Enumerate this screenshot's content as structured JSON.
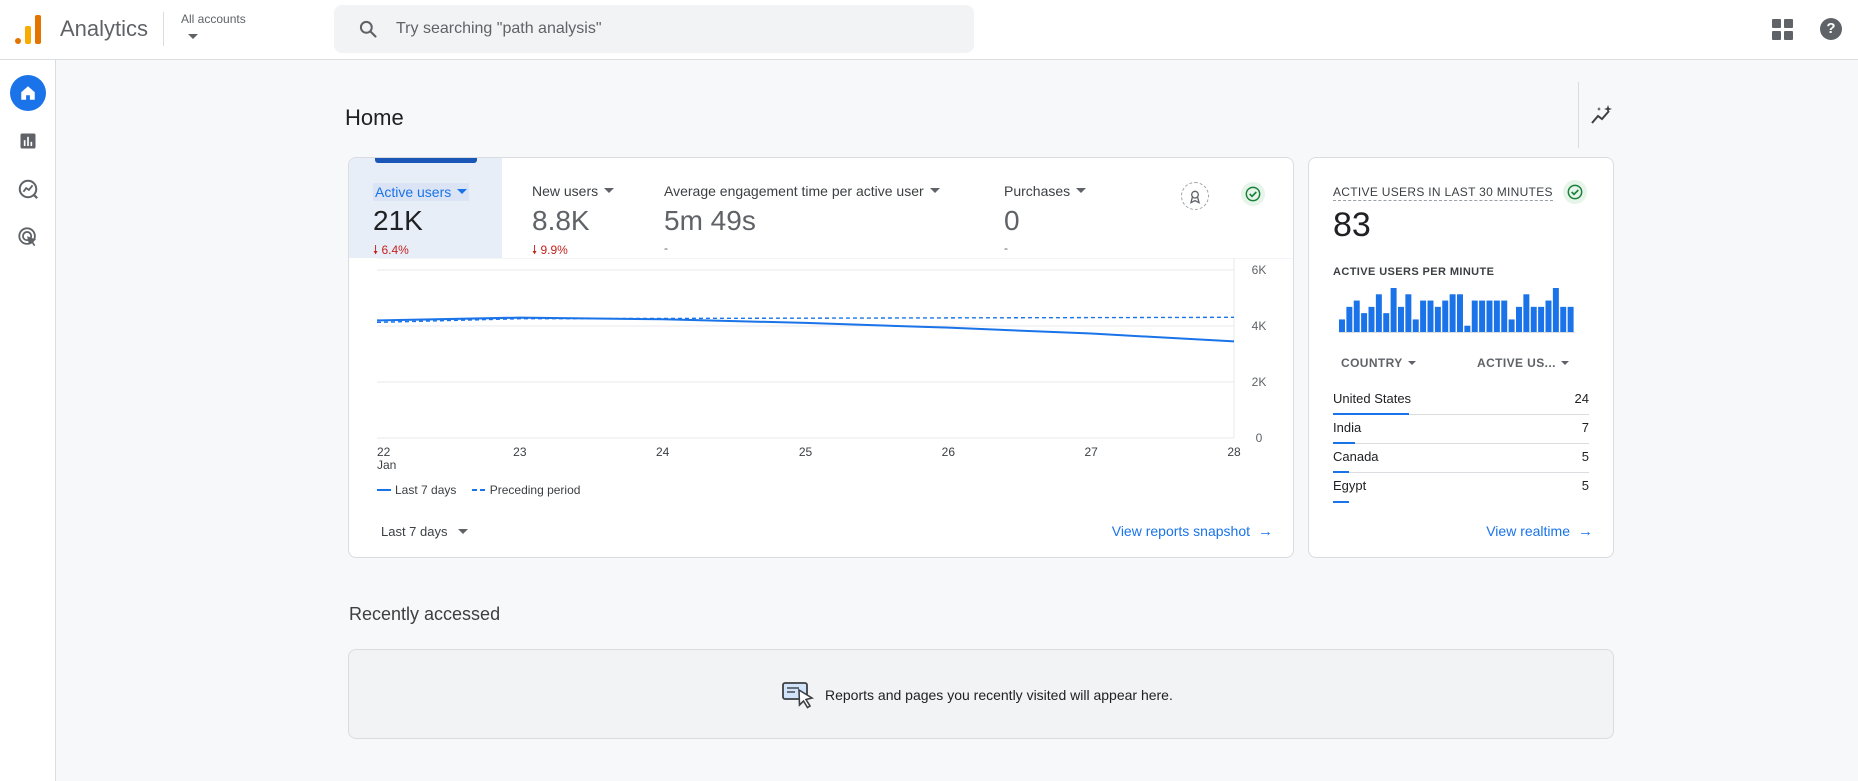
{
  "header": {
    "app_title": "Analytics",
    "accounts_label": "All accounts",
    "search_placeholder": "Try searching \"path analysis\""
  },
  "page": {
    "title": "Home"
  },
  "metrics": [
    {
      "label": "Active users",
      "value": "21K",
      "delta": "6.4%",
      "delta_direction": "down",
      "selected": true
    },
    {
      "label": "New users",
      "value": "8.8K",
      "delta": "9.9%",
      "delta_direction": "down",
      "selected": false
    },
    {
      "label": "Average engagement time per active user",
      "value": "5m 49s",
      "delta": "-",
      "delta_direction": "none",
      "selected": false
    },
    {
      "label": "Purchases",
      "value": "0",
      "delta": "-",
      "delta_direction": "none",
      "selected": false
    }
  ],
  "chart_data": {
    "type": "line",
    "x": [
      "22",
      "23",
      "24",
      "25",
      "26",
      "27",
      "28"
    ],
    "x_sublabel": "Jan",
    "y_ticks": [
      "6K",
      "4K",
      "2K",
      "0"
    ],
    "ylim": [
      0,
      6000
    ],
    "y_axis_position": "right",
    "grid": true,
    "legend": "bottom-left",
    "series": [
      {
        "name": "Last 7 days",
        "style": "solid",
        "color": "#1a73e8",
        "values": [
          4200,
          4300,
          4240,
          4110,
          3940,
          3730,
          3450
        ]
      },
      {
        "name": "Preceding period",
        "style": "dashed",
        "color": "#1a73e8",
        "values": [
          4130,
          4260,
          4270,
          4280,
          4290,
          4300,
          4310
        ]
      }
    ]
  },
  "main_card": {
    "date_range": "Last 7 days",
    "link_label": "View reports snapshot",
    "link_arrow": "→"
  },
  "realtime": {
    "title": "ACTIVE USERS IN LAST 30 MINUTES",
    "value": "83",
    "per_minute_label": "ACTIVE USERS PER MINUTE",
    "per_minute_values": [
      2,
      4,
      5,
      3,
      4,
      6,
      3,
      7,
      4,
      6,
      2,
      5,
      5,
      4,
      5,
      6,
      6,
      1,
      5,
      5,
      5,
      5,
      5,
      2,
      4,
      6,
      4,
      4,
      5,
      7,
      4,
      4
    ],
    "col_country": "COUNTRY",
    "col_users": "ACTIVE US...",
    "rows": [
      {
        "country": "United States",
        "users": "24",
        "share": 1.0
      },
      {
        "country": "India",
        "users": "7",
        "share": 0.29
      },
      {
        "country": "Canada",
        "users": "5",
        "share": 0.21
      },
      {
        "country": "Egypt",
        "users": "5",
        "share": 0.21
      }
    ],
    "link_label": "View realtime",
    "link_arrow": "→"
  },
  "recent": {
    "title": "Recently accessed",
    "empty_text": "Reports and pages you recently visited will appear here."
  },
  "colors": {
    "accent": "#1a73e8",
    "negative": "#c5221f",
    "success": "#188038"
  }
}
